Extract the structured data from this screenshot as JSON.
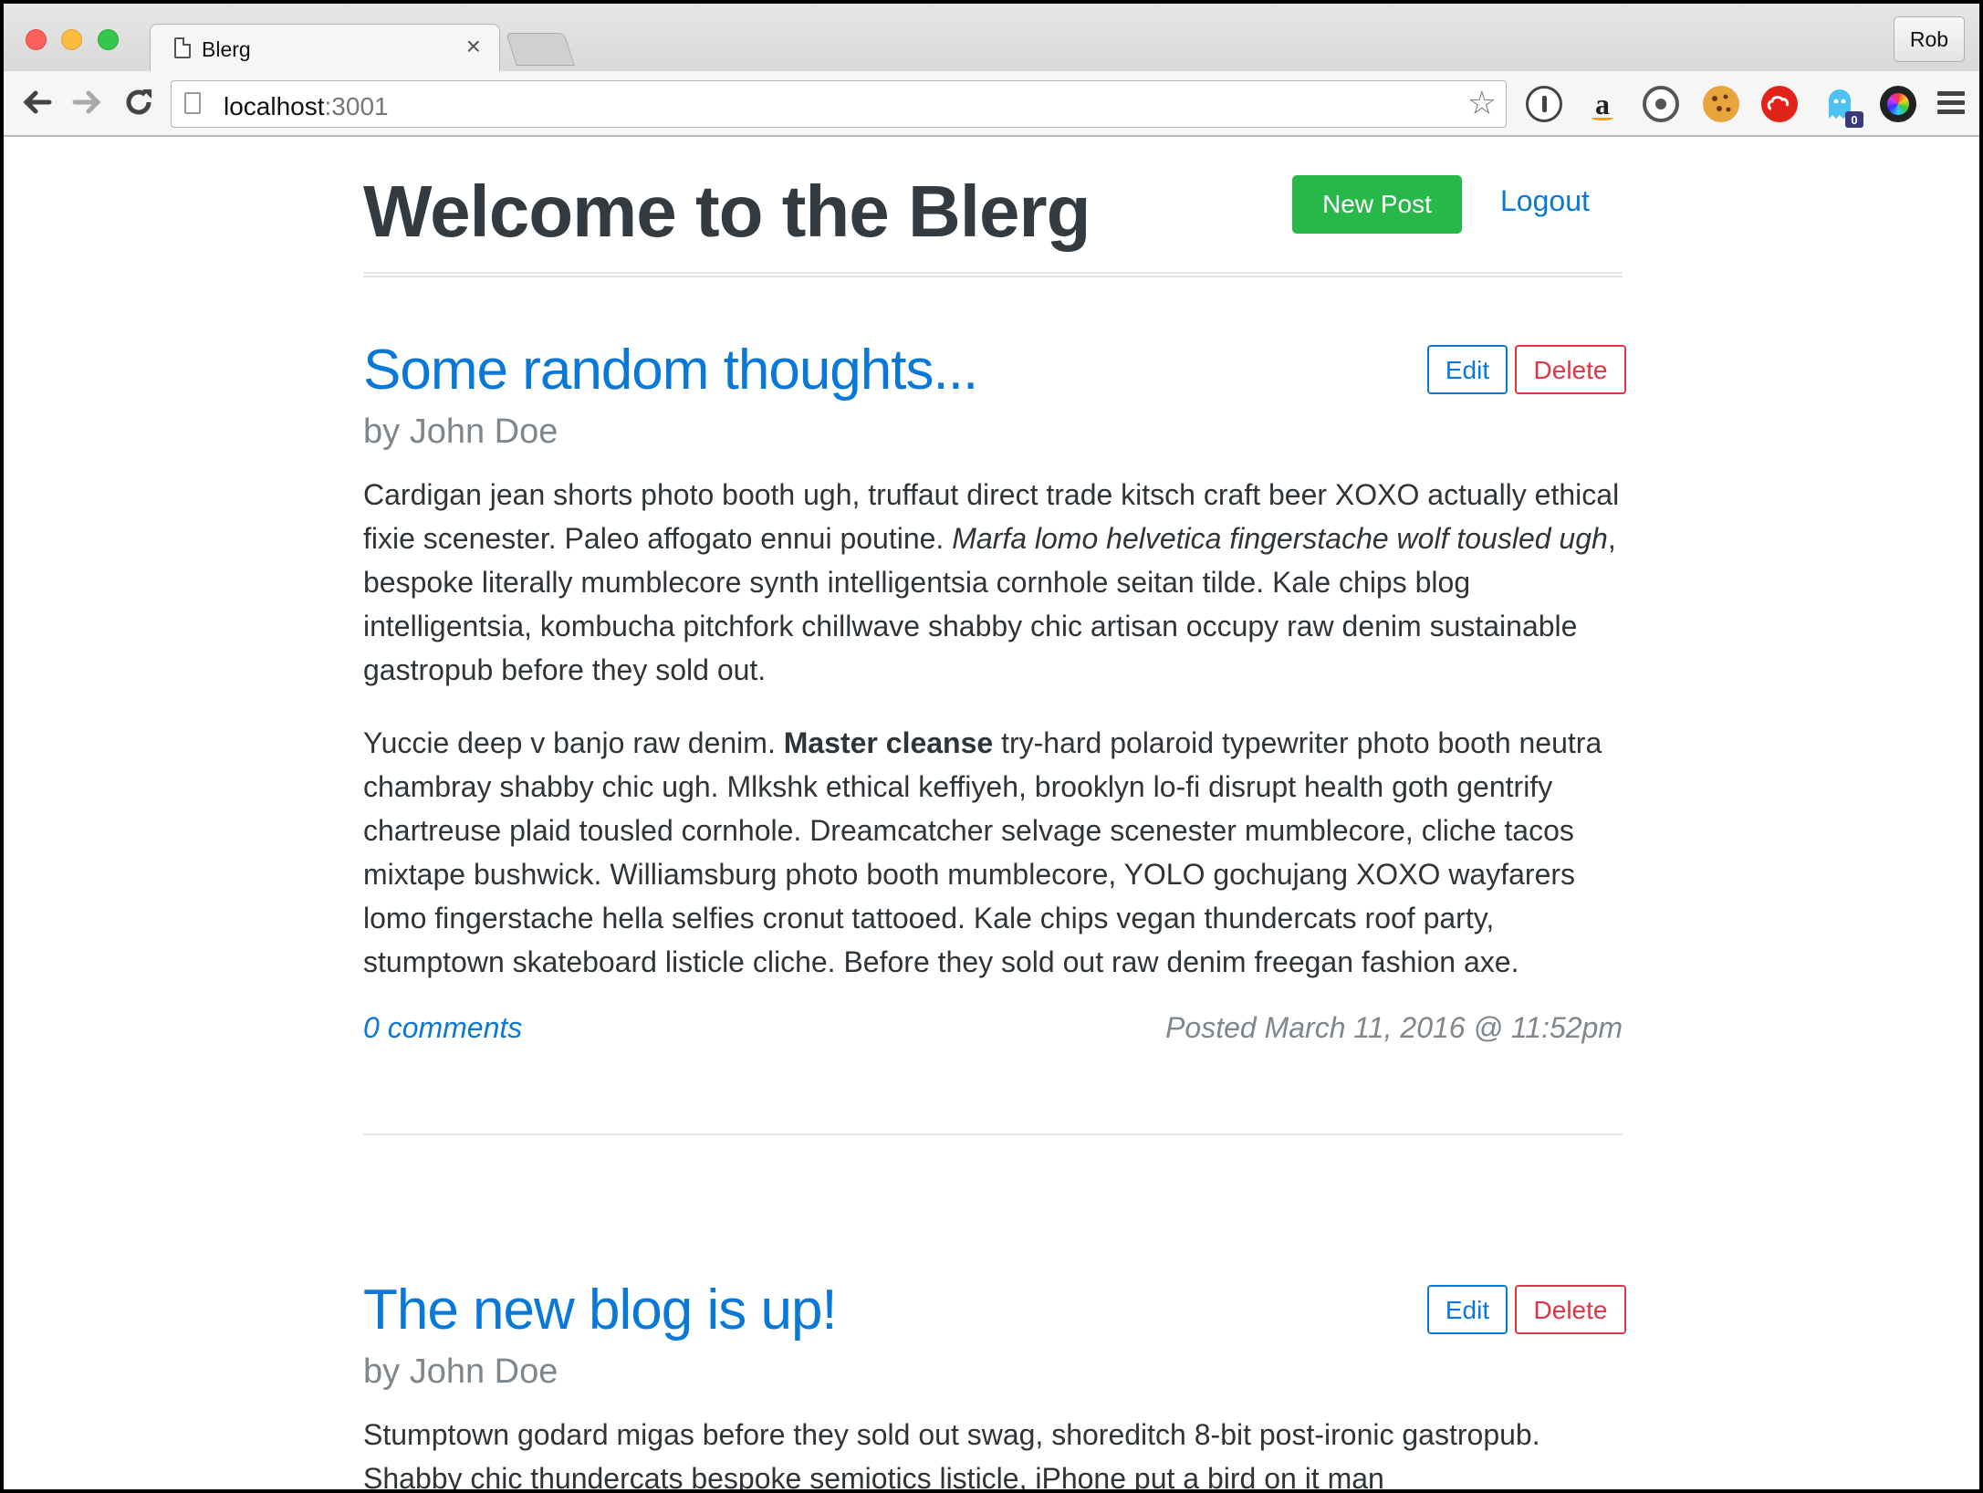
{
  "browser": {
    "tab_title": "Blerg",
    "tab_close": "×",
    "profile_name": "Rob",
    "url_host": "localhost",
    "url_port": ":3001",
    "icons": [
      "back-icon",
      "forward-icon",
      "reload-icon",
      "bookmark-star-icon",
      "1password-icon",
      "amazon-icon",
      "sync-icon",
      "cookie-icon",
      "creative-cloud-icon",
      "ghostery-icon",
      "colorzilla-icon",
      "menu-icon"
    ],
    "ghostery_badge": "0",
    "amazon_glyph": "a"
  },
  "header": {
    "site_title": "Welcome to the Blerg",
    "new_post_label": "New Post",
    "logout_label": "Logout"
  },
  "posts": [
    {
      "title": "Some random thoughts...",
      "author": "by John Doe",
      "edit_label": "Edit",
      "delete_label": "Delete",
      "p1_a": "Cardigan jean shorts photo booth ugh, truffaut direct trade kitsch craft beer XOXO actually ethical fixie scenester. Paleo affogato ennui poutine. ",
      "p1_em": "Marfa lomo helvetica fingerstache wolf tousled ugh",
      "p1_b": ", bespoke literally mumblecore synth intelligentsia cornhole seitan tilde. Kale chips blog intelligentsia, kombucha pitchfork chillwave shabby chic artisan occupy raw denim sustainable gastropub before they sold out.",
      "p2_a": "Yuccie deep v banjo raw denim. ",
      "p2_strong": "Master cleanse",
      "p2_b": " try-hard polaroid typewriter photo booth neutra chambray shabby chic ugh. Mlkshk ethical keffiyeh, brooklyn lo-fi disrupt health goth gentrify chartreuse plaid tousled cornhole. Dreamcatcher selvage scenester mumblecore, cliche tacos mixtape bushwick. Williamsburg photo booth mumblecore, YOLO gochujang XOXO wayfarers lomo fingerstache hella selfies cronut tattooed. Kale chips vegan thundercats roof party, stumptown skateboard listicle cliche. Before they sold out raw denim freegan fashion axe.",
      "comments": "0 comments",
      "posted": "Posted March 11, 2016 @ 11:52pm"
    },
    {
      "title": "The new blog is up!",
      "author": "by John Doe",
      "edit_label": "Edit",
      "delete_label": "Delete",
      "p1": "Stumptown godard migas before they sold out swag, shoreditch 8-bit post-ironic gastropub. Shabby chic thundercats bespoke semiotics listicle, iPhone put a bird on it man"
    }
  ]
}
